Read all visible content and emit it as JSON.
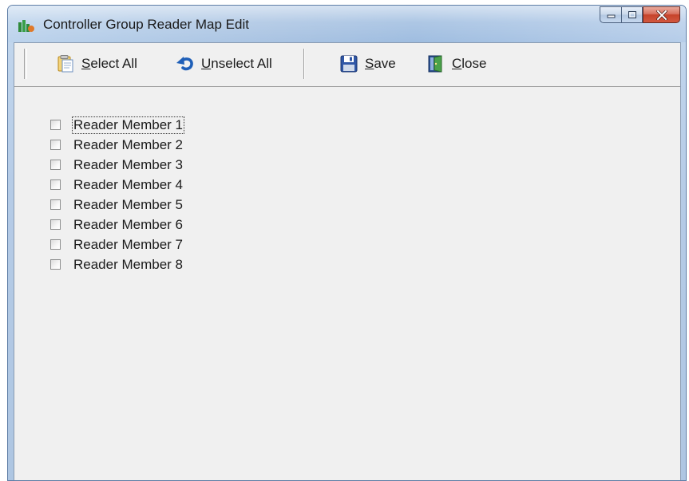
{
  "window": {
    "title": "Controller Group Reader Map Edit"
  },
  "toolbar": {
    "select_all": {
      "accel": "S",
      "rest": "elect All"
    },
    "unselect_all": {
      "accel": "U",
      "rest": "nselect All"
    },
    "save": {
      "accel": "S",
      "rest": "ave"
    },
    "close": {
      "accel": "C",
      "rest": "lose"
    }
  },
  "readers": [
    {
      "label": "Reader Member 1",
      "checked": false,
      "focused": true
    },
    {
      "label": "Reader Member 2",
      "checked": false,
      "focused": false
    },
    {
      "label": "Reader Member 3",
      "checked": false,
      "focused": false
    },
    {
      "label": "Reader Member 4",
      "checked": false,
      "focused": false
    },
    {
      "label": "Reader Member 5",
      "checked": false,
      "focused": false
    },
    {
      "label": "Reader Member 6",
      "checked": false,
      "focused": false
    },
    {
      "label": "Reader Member 7",
      "checked": false,
      "focused": false
    },
    {
      "label": "Reader Member 8",
      "checked": false,
      "focused": false
    }
  ],
  "icons": {
    "app": "app-icon",
    "select_all": "clipboard-icon",
    "unselect_all": "undo-arrow-icon",
    "save": "floppy-disk-icon",
    "close": "door-exit-icon"
  }
}
